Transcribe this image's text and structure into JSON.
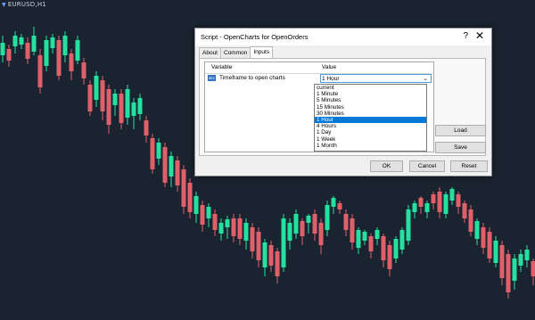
{
  "chart": {
    "symbol": "EURUSD,H1",
    "colors": {
      "bull": "#26e0a0",
      "bear": "#e0606a",
      "background": "#1a2330"
    }
  },
  "dialog": {
    "title": "Script - OpenCharts for OpenOrders",
    "help": "?",
    "close": "✕",
    "tabs": [
      "About",
      "Common",
      "Inputs"
    ],
    "active_tab": "Inputs",
    "grid": {
      "col_variable": "Variable",
      "col_value": "Value",
      "row": {
        "icon": "abc",
        "name": "Timeframe to open charts",
        "value": "1 Hour"
      }
    },
    "dropdown_options": [
      "current",
      "1 Minute",
      "5 Minutes",
      "15 Minutes",
      "30 Minutes",
      "1 Hour",
      "4 Hours",
      "1 Day",
      "1 Week",
      "1 Month"
    ],
    "selected_option": "1 Hour",
    "buttons": {
      "load": "Load",
      "save": "Save",
      "ok": "OK",
      "cancel": "Cancel",
      "reset": "Reset"
    }
  }
}
